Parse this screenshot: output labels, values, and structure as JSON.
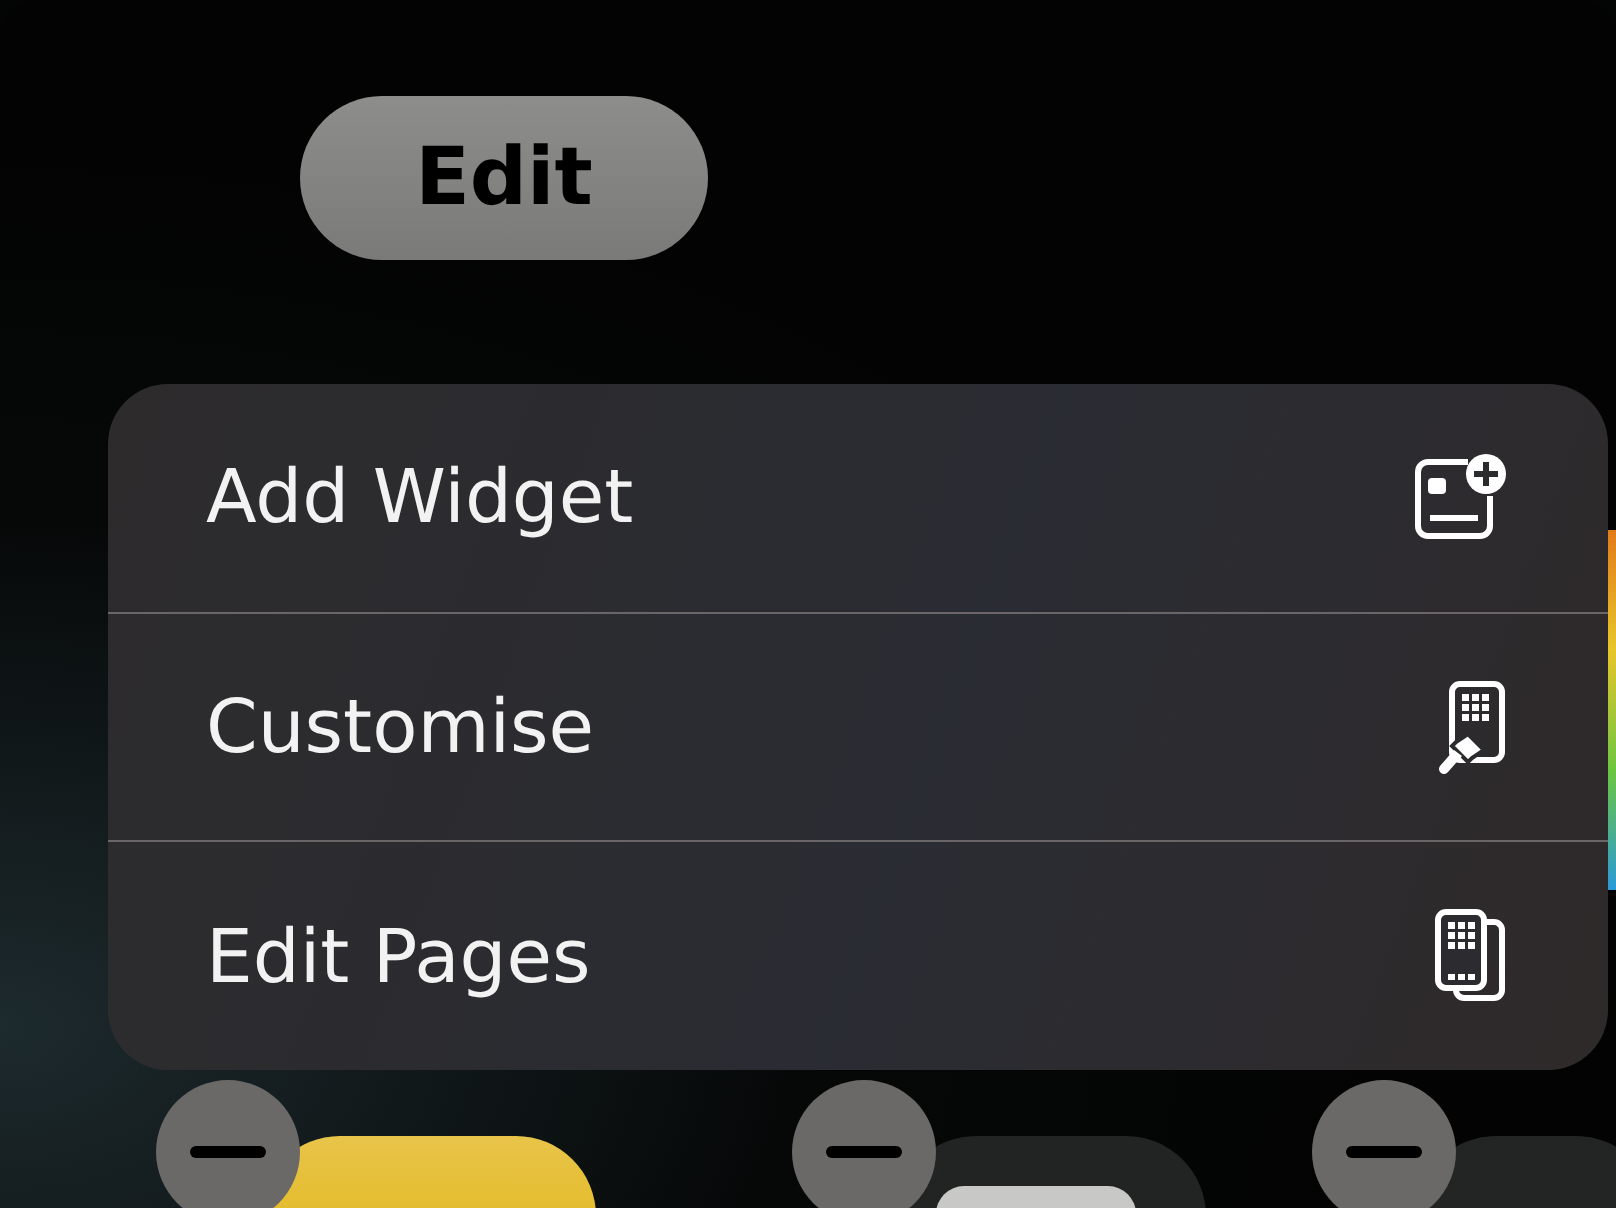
{
  "edit_button": {
    "label": "Edit"
  },
  "menu": {
    "items": [
      {
        "label": "Add Widget",
        "kind": "widget"
      },
      {
        "label": "Customise",
        "kind": "brush"
      },
      {
        "label": "Edit Pages",
        "kind": "pages"
      }
    ]
  }
}
